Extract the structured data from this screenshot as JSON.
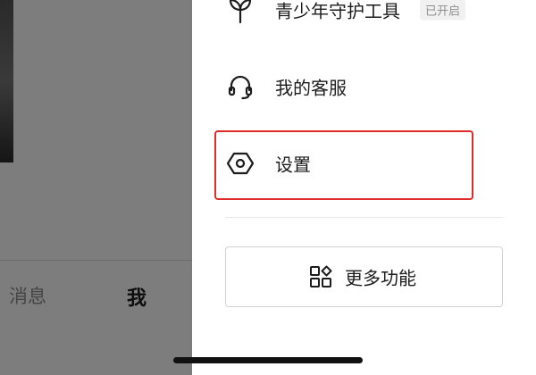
{
  "left_pane": {
    "tabs": {
      "messages": "消息",
      "me": "我"
    }
  },
  "drawer": {
    "items": [
      {
        "label": "青少年守护工具",
        "icon": "sprout-icon",
        "badge": "已开启"
      },
      {
        "label": "我的客服",
        "icon": "headset-icon"
      },
      {
        "label": "设置",
        "icon": "hexagon-settings-icon",
        "highlighted": true
      }
    ],
    "more_button": {
      "label": "更多功能",
      "icon": "apps-grid-icon"
    }
  },
  "colors": {
    "overlay": "#7d7d7d",
    "highlight_border": "#e02b2b",
    "text": "#1c1c1c",
    "badge_text": "#8f8f8f",
    "badge_bg": "#f1f1f1"
  }
}
